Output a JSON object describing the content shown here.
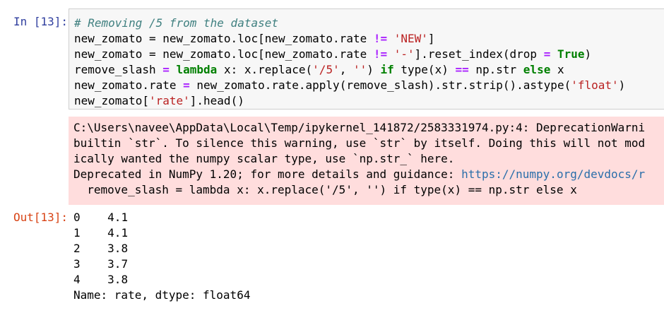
{
  "cell": {
    "in_prompt": "In [13]:",
    "out_prompt": "Out[13]:",
    "code": {
      "line1_comment": "# Removing /5 from the dataset",
      "line2_a": "new_zomato = new_zomato.loc[new_zomato.rate ",
      "line2_op": "!=",
      "line2_b": " ",
      "line2_str": "'NEW'",
      "line2_c": "]",
      "line3_a": "new_zomato = new_zomato.loc[new_zomato.rate ",
      "line3_op": "!=",
      "line3_b": " ",
      "line3_str": "'-'",
      "line3_c": "].reset_index(drop ",
      "line3_op2": "=",
      "line3_d": " ",
      "line3_kw": "True",
      "line3_e": ")",
      "line4_a": "remove_slash ",
      "line4_op": "=",
      "line4_b": " ",
      "line4_kw": "lambda",
      "line4_c": " x: x.replace(",
      "line4_str1": "'/5'",
      "line4_d": ", ",
      "line4_str2": "''",
      "line4_e": ") ",
      "line4_kw2": "if",
      "line4_f": " type(x) ",
      "line4_op2": "==",
      "line4_g": " np.str ",
      "line4_kw3": "else",
      "line4_h": " x",
      "line5_a": "new_zomato.rate ",
      "line5_op": "=",
      "line5_b": " new_zomato.rate.apply(remove_slash).str.strip().astype(",
      "line5_str": "'float'",
      "line5_c": ")",
      "line6_a": "new_zomato[",
      "line6_str": "'rate'",
      "line6_b": "].head()"
    },
    "stderr": {
      "line1": "C:\\Users\\navee\\AppData\\Local\\Temp/ipykernel_141872/2583331974.py:4: DeprecationWarni",
      "line2": "builtin `str`. To silence this warning, use `str` by itself. Doing this will not mod",
      "line3": "ically wanted the numpy scalar type, use `np.str_` here.",
      "line4_text": "Deprecated in NumPy 1.20; for more details and guidance: ",
      "line4_link": "https://numpy.org/devdocs/r",
      "line5": "  remove_slash = lambda x: x.replace('/5', '') if type(x) == np.str else x"
    },
    "output": {
      "rows": [
        {
          "index": "0",
          "value": "4.1"
        },
        {
          "index": "1",
          "value": "4.1"
        },
        {
          "index": "2",
          "value": "3.8"
        },
        {
          "index": "3",
          "value": "3.7"
        },
        {
          "index": "4",
          "value": "3.8"
        }
      ],
      "footer": "Name: rate, dtype: float64"
    }
  }
}
